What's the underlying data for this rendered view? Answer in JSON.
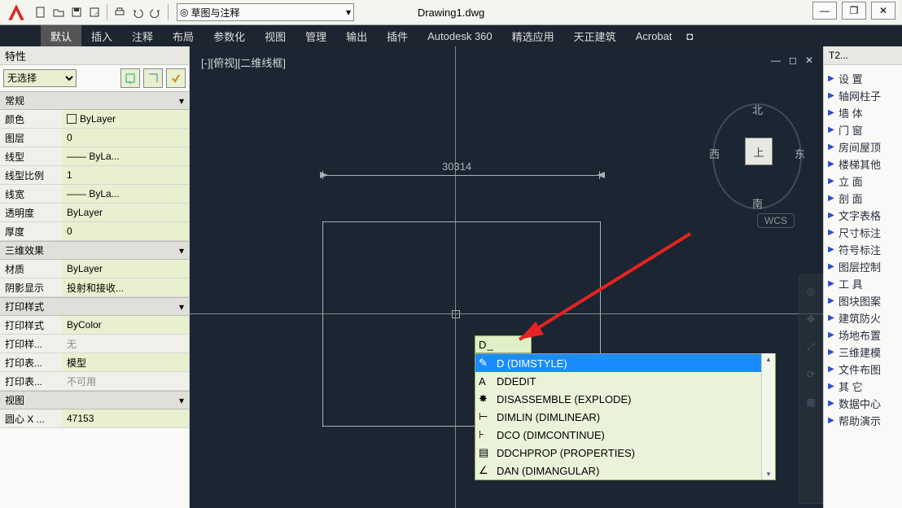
{
  "titlebar": {
    "doc": "Drawing1.dwg",
    "workspace": "草图与注释",
    "win_min": "—",
    "win_max": "❐",
    "win_close": "✕"
  },
  "ribbon": {
    "tabs": [
      "默认",
      "插入",
      "注释",
      "布局",
      "参数化",
      "视图",
      "管理",
      "输出",
      "插件",
      "Autodesk 360",
      "精选应用",
      "天正建筑",
      "Acrobat"
    ],
    "active": 0,
    "minimize": "◘"
  },
  "prop_panel": {
    "title": "特性",
    "no_selection": "无选择",
    "sections": {
      "general": {
        "label": "常规",
        "rows": [
          {
            "k": "颜色",
            "v": "ByLayer",
            "swatch": true
          },
          {
            "k": "图层",
            "v": "0"
          },
          {
            "k": "线型",
            "v": "—— ByLa..."
          },
          {
            "k": "线型比例",
            "v": "1"
          },
          {
            "k": "线宽",
            "v": "—— ByLa..."
          },
          {
            "k": "透明度",
            "v": "ByLayer"
          },
          {
            "k": "厚度",
            "v": "0"
          }
        ]
      },
      "threeD": {
        "label": "三维效果",
        "rows": [
          {
            "k": "材质",
            "v": "ByLayer"
          },
          {
            "k": "阴影显示",
            "v": "投射和接收..."
          }
        ]
      },
      "plot": {
        "label": "打印样式",
        "rows": [
          {
            "k": "打印样式",
            "v": "ByColor"
          },
          {
            "k": "打印样...",
            "v": "无",
            "ro": true
          },
          {
            "k": "打印表...",
            "v": "模型"
          },
          {
            "k": "打印表...",
            "v": "不可用",
            "ro": true
          }
        ]
      },
      "view": {
        "label": "视图",
        "rows": [
          {
            "k": "圆心 X ...",
            "v": "47153"
          }
        ]
      }
    }
  },
  "canvas": {
    "viewlabel": "[-][俯视][二维线框]",
    "dim_value": "30314",
    "compass": {
      "n": "北",
      "s": "南",
      "e": "东",
      "w": "西",
      "top": "上"
    },
    "wcs": "WCS"
  },
  "cmd": {
    "input": "D",
    "items": [
      {
        "txt": "D (DIMSTYLE)",
        "sel": true,
        "ic": "dim"
      },
      {
        "txt": "DDEDIT",
        "ic": "edit"
      },
      {
        "txt": "DISASSEMBLE (EXPLODE)",
        "ic": "exp"
      },
      {
        "txt": "DIMLIN (DIMLINEAR)",
        "ic": "lin"
      },
      {
        "txt": "DCO (DIMCONTINUE)",
        "ic": "cont"
      },
      {
        "txt": "DDCHPROP (PROPERTIES)",
        "ic": "prop"
      },
      {
        "txt": "DAN (DIMANGULAR)",
        "ic": "ang"
      }
    ]
  },
  "right_panel": {
    "title": "T2...",
    "items": [
      "设   置",
      "轴网柱子",
      "墙   体",
      "门   窗",
      "房间屋顶",
      "楼梯其他",
      "立   面",
      "剖   面",
      "文字表格",
      "尺寸标注",
      "符号标注",
      "图层控制",
      "工   具",
      "图块图案",
      "建筑防火",
      "场地布置",
      "三维建模",
      "文件布图",
      "其   它",
      "数据中心",
      "帮助演示"
    ]
  }
}
